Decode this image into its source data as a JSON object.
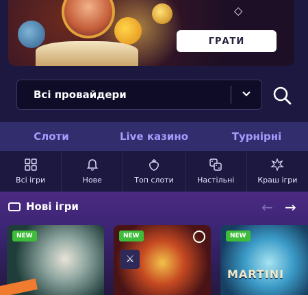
{
  "banner": {
    "play_label": "ГРАТИ"
  },
  "provider": {
    "selected": "Всі провайдери"
  },
  "tabs": [
    {
      "label": "Слоти"
    },
    {
      "label": "Live казино"
    },
    {
      "label": "Турнірні"
    }
  ],
  "categories": [
    {
      "label": "Всі ігри",
      "icon": "grid-icon"
    },
    {
      "label": "Нове",
      "icon": "bell-icon"
    },
    {
      "label": "Топ слоти",
      "icon": "strawberry-icon"
    },
    {
      "label": "Настільні",
      "icon": "dice-icon"
    },
    {
      "label": "Краш ігри",
      "icon": "explosion-icon"
    }
  ],
  "new_games": {
    "title": "Нові ігри",
    "cards": [
      {
        "badge": "NEW"
      },
      {
        "badge": "NEW"
      },
      {
        "badge": "NEW",
        "name": "MARTINI"
      }
    ]
  },
  "colors": {
    "background": "#1c1840",
    "tab_bar": "#322d6c",
    "tab_text": "#a49dff",
    "new_badge": "#3ebd3a"
  }
}
